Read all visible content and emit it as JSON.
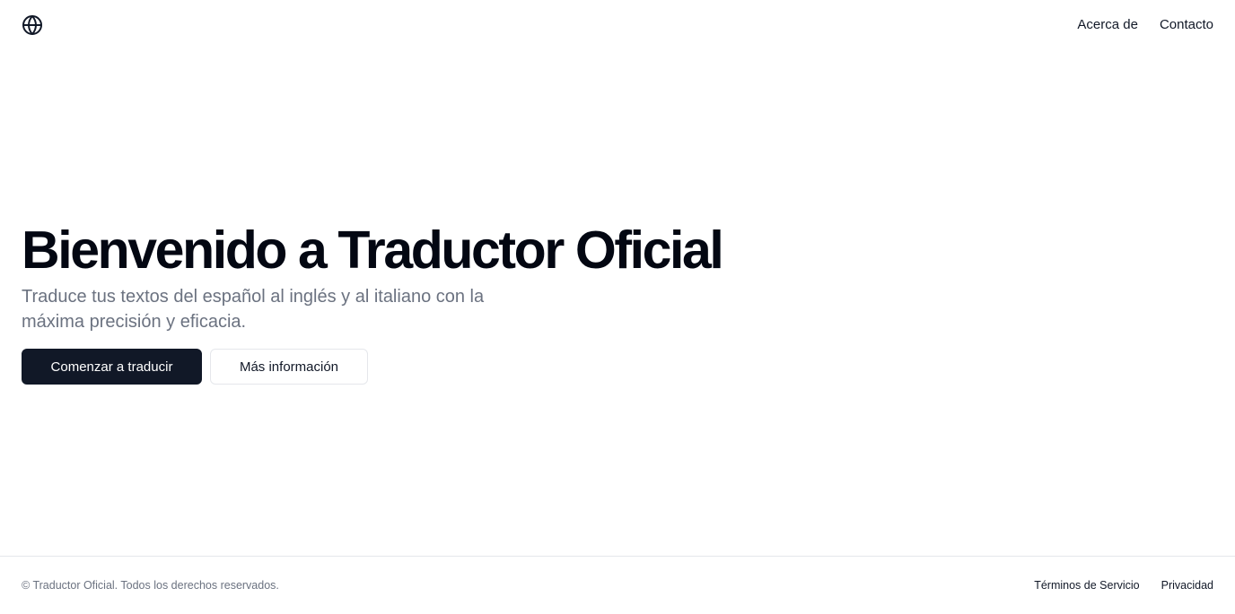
{
  "header": {
    "logo_icon": "globe-icon",
    "nav": [
      {
        "label": "Acerca de"
      },
      {
        "label": "Contacto"
      }
    ]
  },
  "hero": {
    "title": "Bienvenido a Traductor Oficial",
    "subtitle": "Traduce tus textos del español al inglés y al italiano con la máxima precisión y eficacia.",
    "primary_button": "Comenzar a traducir",
    "secondary_button": "Más información"
  },
  "footer": {
    "copyright": "© Traductor Oficial. Todos los derechos reservados.",
    "links": [
      {
        "label": "Términos de Servicio"
      },
      {
        "label": "Privacidad"
      }
    ]
  },
  "colors": {
    "primary": "#111827",
    "muted_text": "#6b7280",
    "border": "#e5e7eb",
    "background": "#ffffff"
  }
}
